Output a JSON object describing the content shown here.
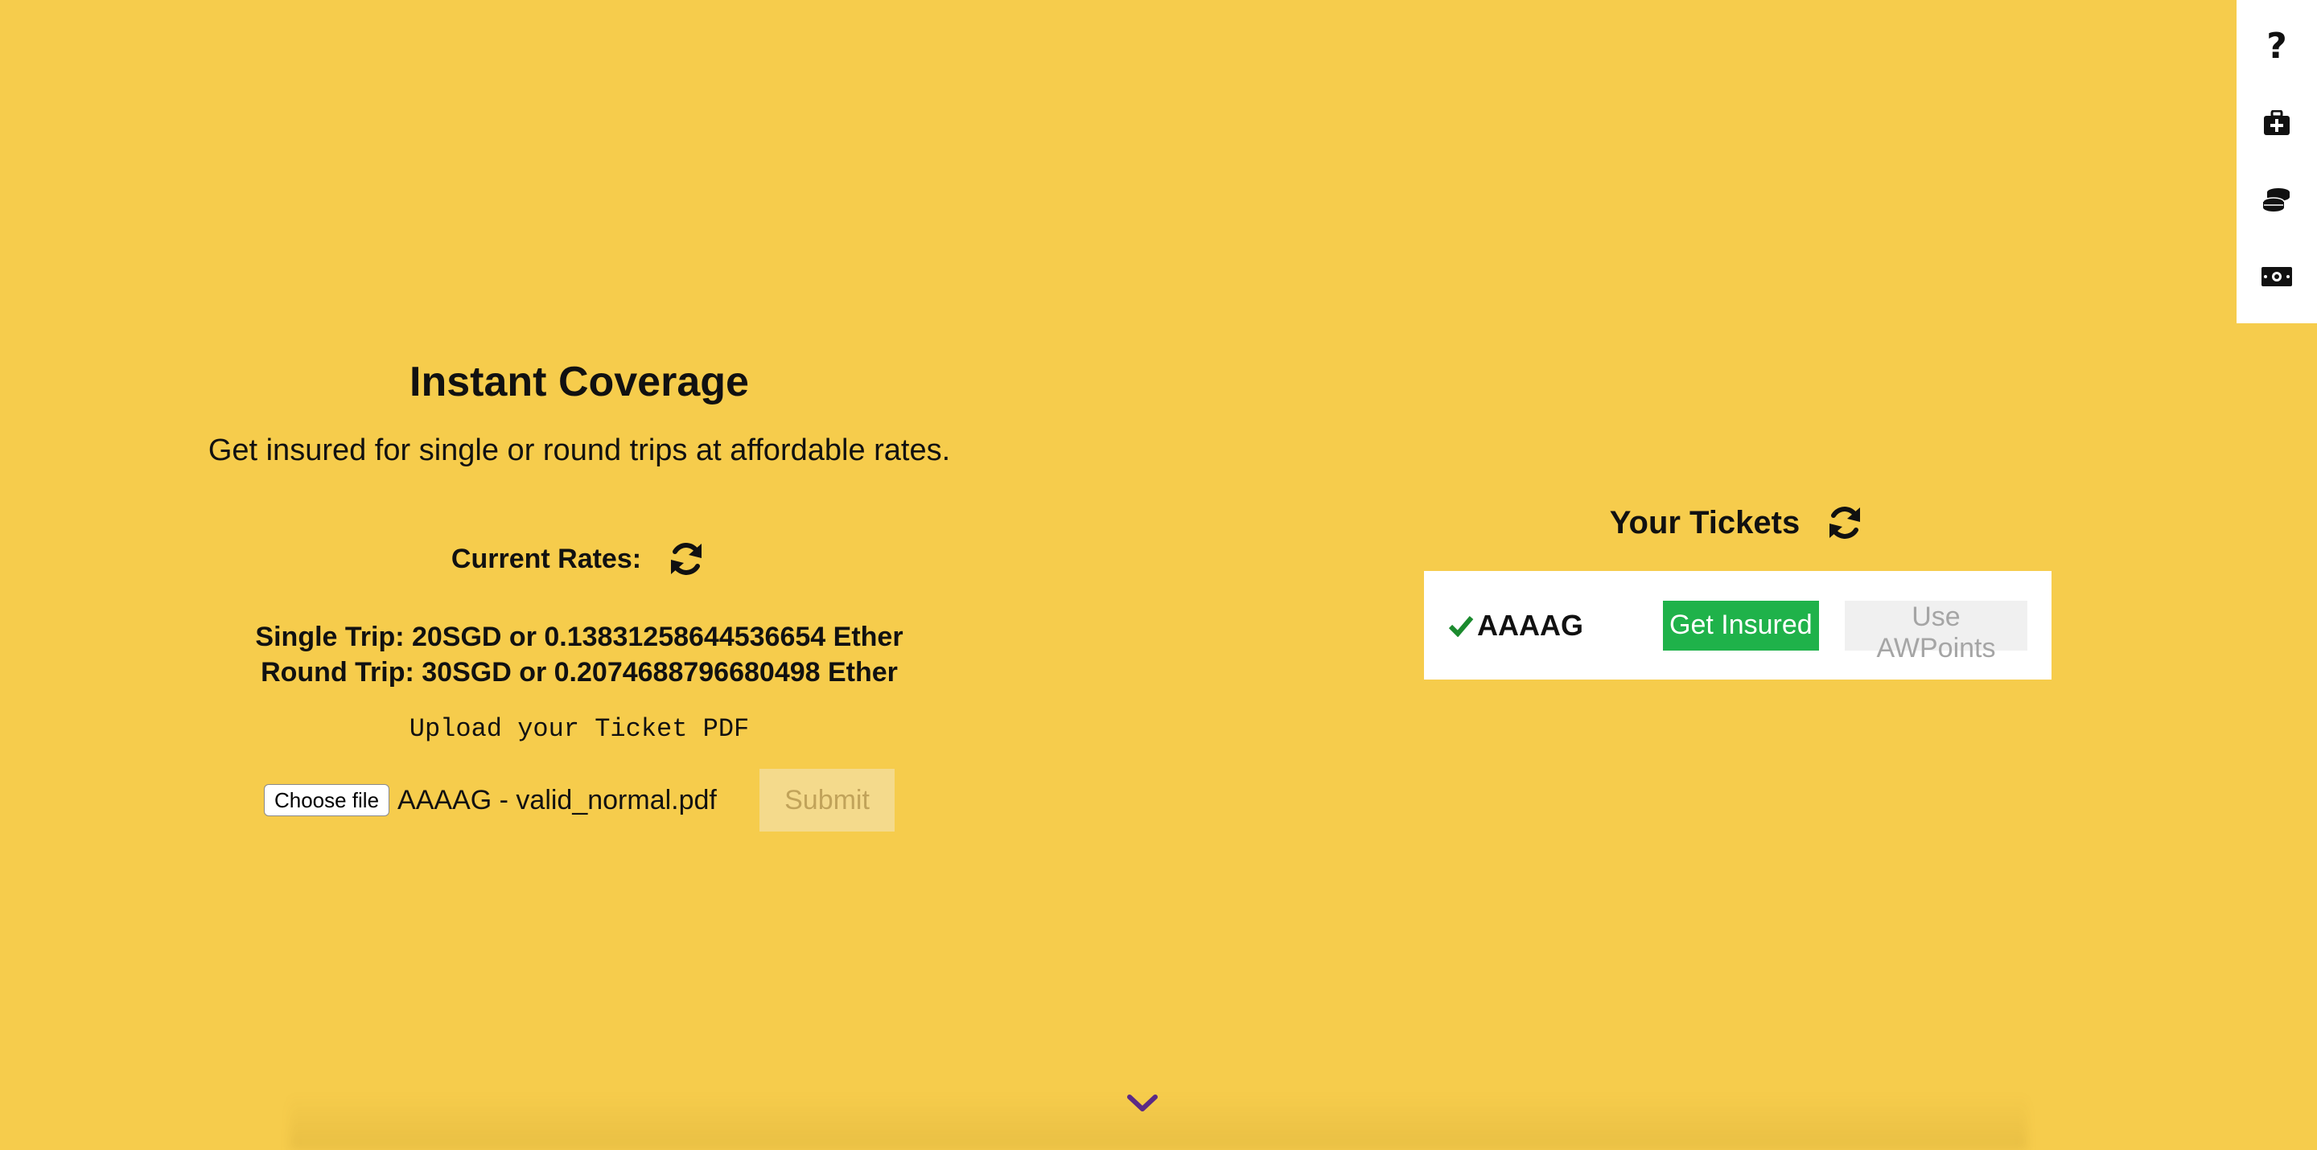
{
  "side_rail": {
    "icons": [
      "question-icon",
      "medkit-icon",
      "coins-icon",
      "money-bill-icon"
    ],
    "help_glyph": "?"
  },
  "coverage": {
    "title": "Instant Coverage",
    "subtitle": "Get insured for single or round trips at affordable rates.",
    "rates_label": "Current Rates:",
    "single_trip": "Single Trip: 20SGD or 0.13831258644536654 Ether",
    "round_trip": "Round Trip: 30SGD or 0.2074688796680498 Ether",
    "upload_label": "Upload your Ticket PDF",
    "choose_file_label": "Choose file",
    "file_name": "AAAAG - valid_normal.pdf",
    "submit_label": "Submit"
  },
  "tickets": {
    "title": "Your Tickets",
    "items": [
      {
        "id": "AAAAG",
        "get_insured_label": "Get Insured",
        "use_points_label": "Use AWPoints"
      }
    ]
  },
  "colors": {
    "background": "#f6cc4c",
    "get_insured": "#1fb24a",
    "check": "#1b8a2e",
    "chevron": "#5b2a86"
  }
}
